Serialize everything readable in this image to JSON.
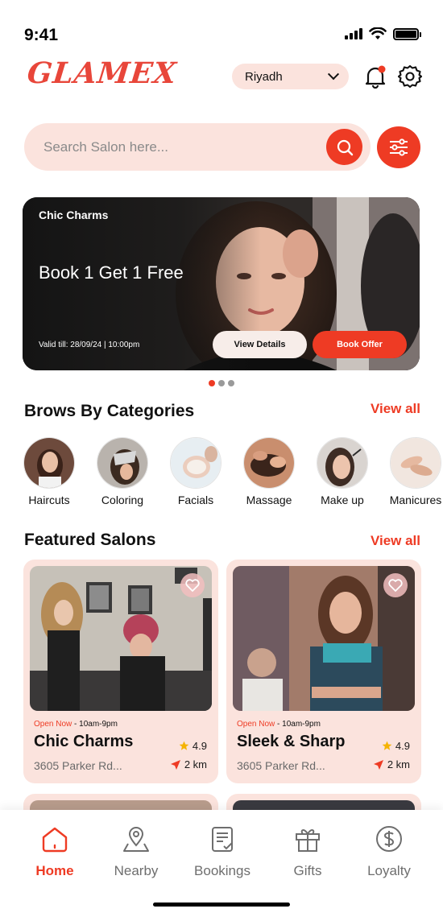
{
  "status_bar": {
    "time": "9:41"
  },
  "header": {
    "logo": "GLAMEX",
    "location": "Riyadh"
  },
  "search": {
    "placeholder": "Search Salon here..."
  },
  "banner": {
    "salon": "Chic Charms",
    "offer": "Book 1 Get 1 Free",
    "valid": "Valid till:  28/09/24  | 10:00pm",
    "view_details_label": "View Details",
    "book_offer_label": "Book Offer",
    "active_slide": 1,
    "slide_count": 3
  },
  "categories": {
    "title": "Brows By Categories",
    "view_all": "View all",
    "items": [
      {
        "label": "Haircuts"
      },
      {
        "label": "Coloring"
      },
      {
        "label": "Facials"
      },
      {
        "label": "Massage"
      },
      {
        "label": "Make up"
      },
      {
        "label": "Manicures"
      }
    ]
  },
  "featured": {
    "title": "Featured Salons",
    "view_all": "View all",
    "salons": [
      {
        "open": "Open Now",
        "hours": " - 10am-9pm",
        "name": "Chic Charms",
        "rating": "4.9",
        "address": "3605 Parker Rd...",
        "distance": "2 km"
      },
      {
        "open": "Open Now",
        "hours": " - 10am-9pm",
        "name": "Sleek & Sharp",
        "rating": "4.9",
        "address": "3605 Parker Rd...",
        "distance": "2 km"
      }
    ]
  },
  "nav": {
    "items": [
      {
        "label": "Home",
        "icon": "home-icon",
        "active": true
      },
      {
        "label": "Nearby",
        "icon": "map-pin-icon"
      },
      {
        "label": "Bookings",
        "icon": "clipboard-icon"
      },
      {
        "label": "Gifts",
        "icon": "gift-icon"
      },
      {
        "label": "Loyalty",
        "icon": "dollar-coin-icon"
      }
    ]
  },
  "colors": {
    "accent": "#ee3b24",
    "soft": "#fbe3dd"
  }
}
